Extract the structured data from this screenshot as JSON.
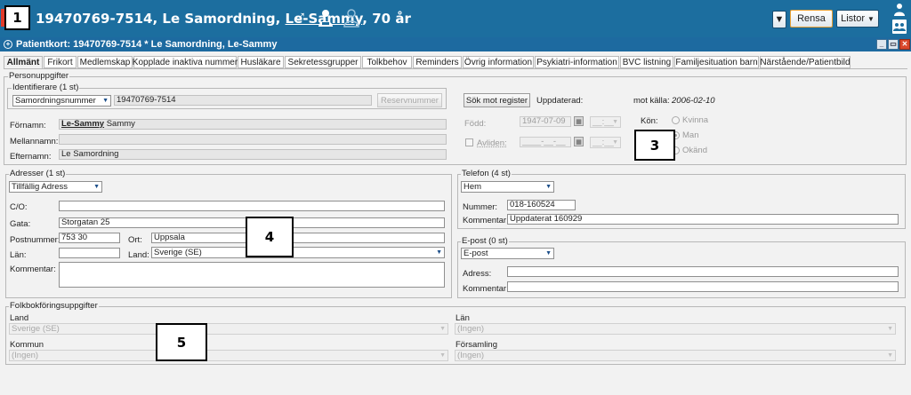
{
  "header": {
    "id": "19470769-7514,",
    "surname": "Le Samordning,",
    "firstname": "Le-Sammy",
    "age": "70 år",
    "clear_label": "Rensa",
    "lists_label": "Listor"
  },
  "card": {
    "title": "Patientkort: 19470769-7514 * Le Samordning, Le-Sammy"
  },
  "tabs": [
    "Allmänt",
    "Frikort",
    "Medlemskap",
    "Kopplade inaktiva nummer",
    "Husläkare",
    "Sekretessgrupper",
    "Tolkbehov",
    "Reminders",
    "Övrig information",
    "Psykiatri-information",
    "BVC listning",
    "Familjesituation barn",
    "Närstående/Patientbild"
  ],
  "person": {
    "group_title": "Personuppgifter",
    "ident_title": "Identifierare (1 st)",
    "ident_type": "Samordningsnummer",
    "ident_value": "19470769-7514",
    "reserve_label": "Reservnummer",
    "search_label": "Sök mot register",
    "updated_label": "Uppdaterad:",
    "source_label": "mot källa:",
    "source_date": "2006-02-10",
    "firstname_label": "Förnamn:",
    "firstname_u": "Le-Sammy",
    "firstname_rest": "Sammy",
    "middlename_label": "Mellannamn:",
    "lastname_label": "Efternamn:",
    "lastname_value": "Le Samordning",
    "born_label": "Född:",
    "born_value": "1947-07-09",
    "born_time": "__:__",
    "dead_label": "Avliden:",
    "dead_value": "____-__-__",
    "dead_time": "__:__",
    "gender_label": "Kön:",
    "gender_options": [
      "Kvinna",
      "Man",
      "Okänd"
    ]
  },
  "address": {
    "group_title": "Adresser (1 st)",
    "type": "Tillfällig Adress",
    "co_label": "C/O:",
    "street_label": "Gata:",
    "street_value": "Storgatan 25",
    "zip_label": "Postnummer:",
    "zip_value": "753 30",
    "city_label": "Ort:",
    "city_value": "Uppsala",
    "county_label": "Län:",
    "country_label": "Land:",
    "country_value": "Sverige (SE)",
    "comment_label": "Kommentar:"
  },
  "phone": {
    "group_title": "Telefon (4 st)",
    "type": "Hem",
    "number_label": "Nummer:",
    "number_value": "018-160524",
    "comment_label": "Kommentar:",
    "comment_value": "Uppdaterat 160929"
  },
  "email": {
    "group_title": "E-post (0 st)",
    "type": "E-post",
    "address_label": "Adress:",
    "comment_label": "Kommentar:"
  },
  "registry": {
    "group_title": "Folkbokföringsuppgifter",
    "country_label": "Land",
    "country_value": "Sverige (SE)",
    "county_label": "Län",
    "county_value": "(Ingen)",
    "municipality_label": "Kommun",
    "municipality_value": "(Ingen)",
    "parish_label": "Församling",
    "parish_value": "(Ingen)"
  },
  "callouts": [
    "1",
    "3",
    "4",
    "5"
  ]
}
